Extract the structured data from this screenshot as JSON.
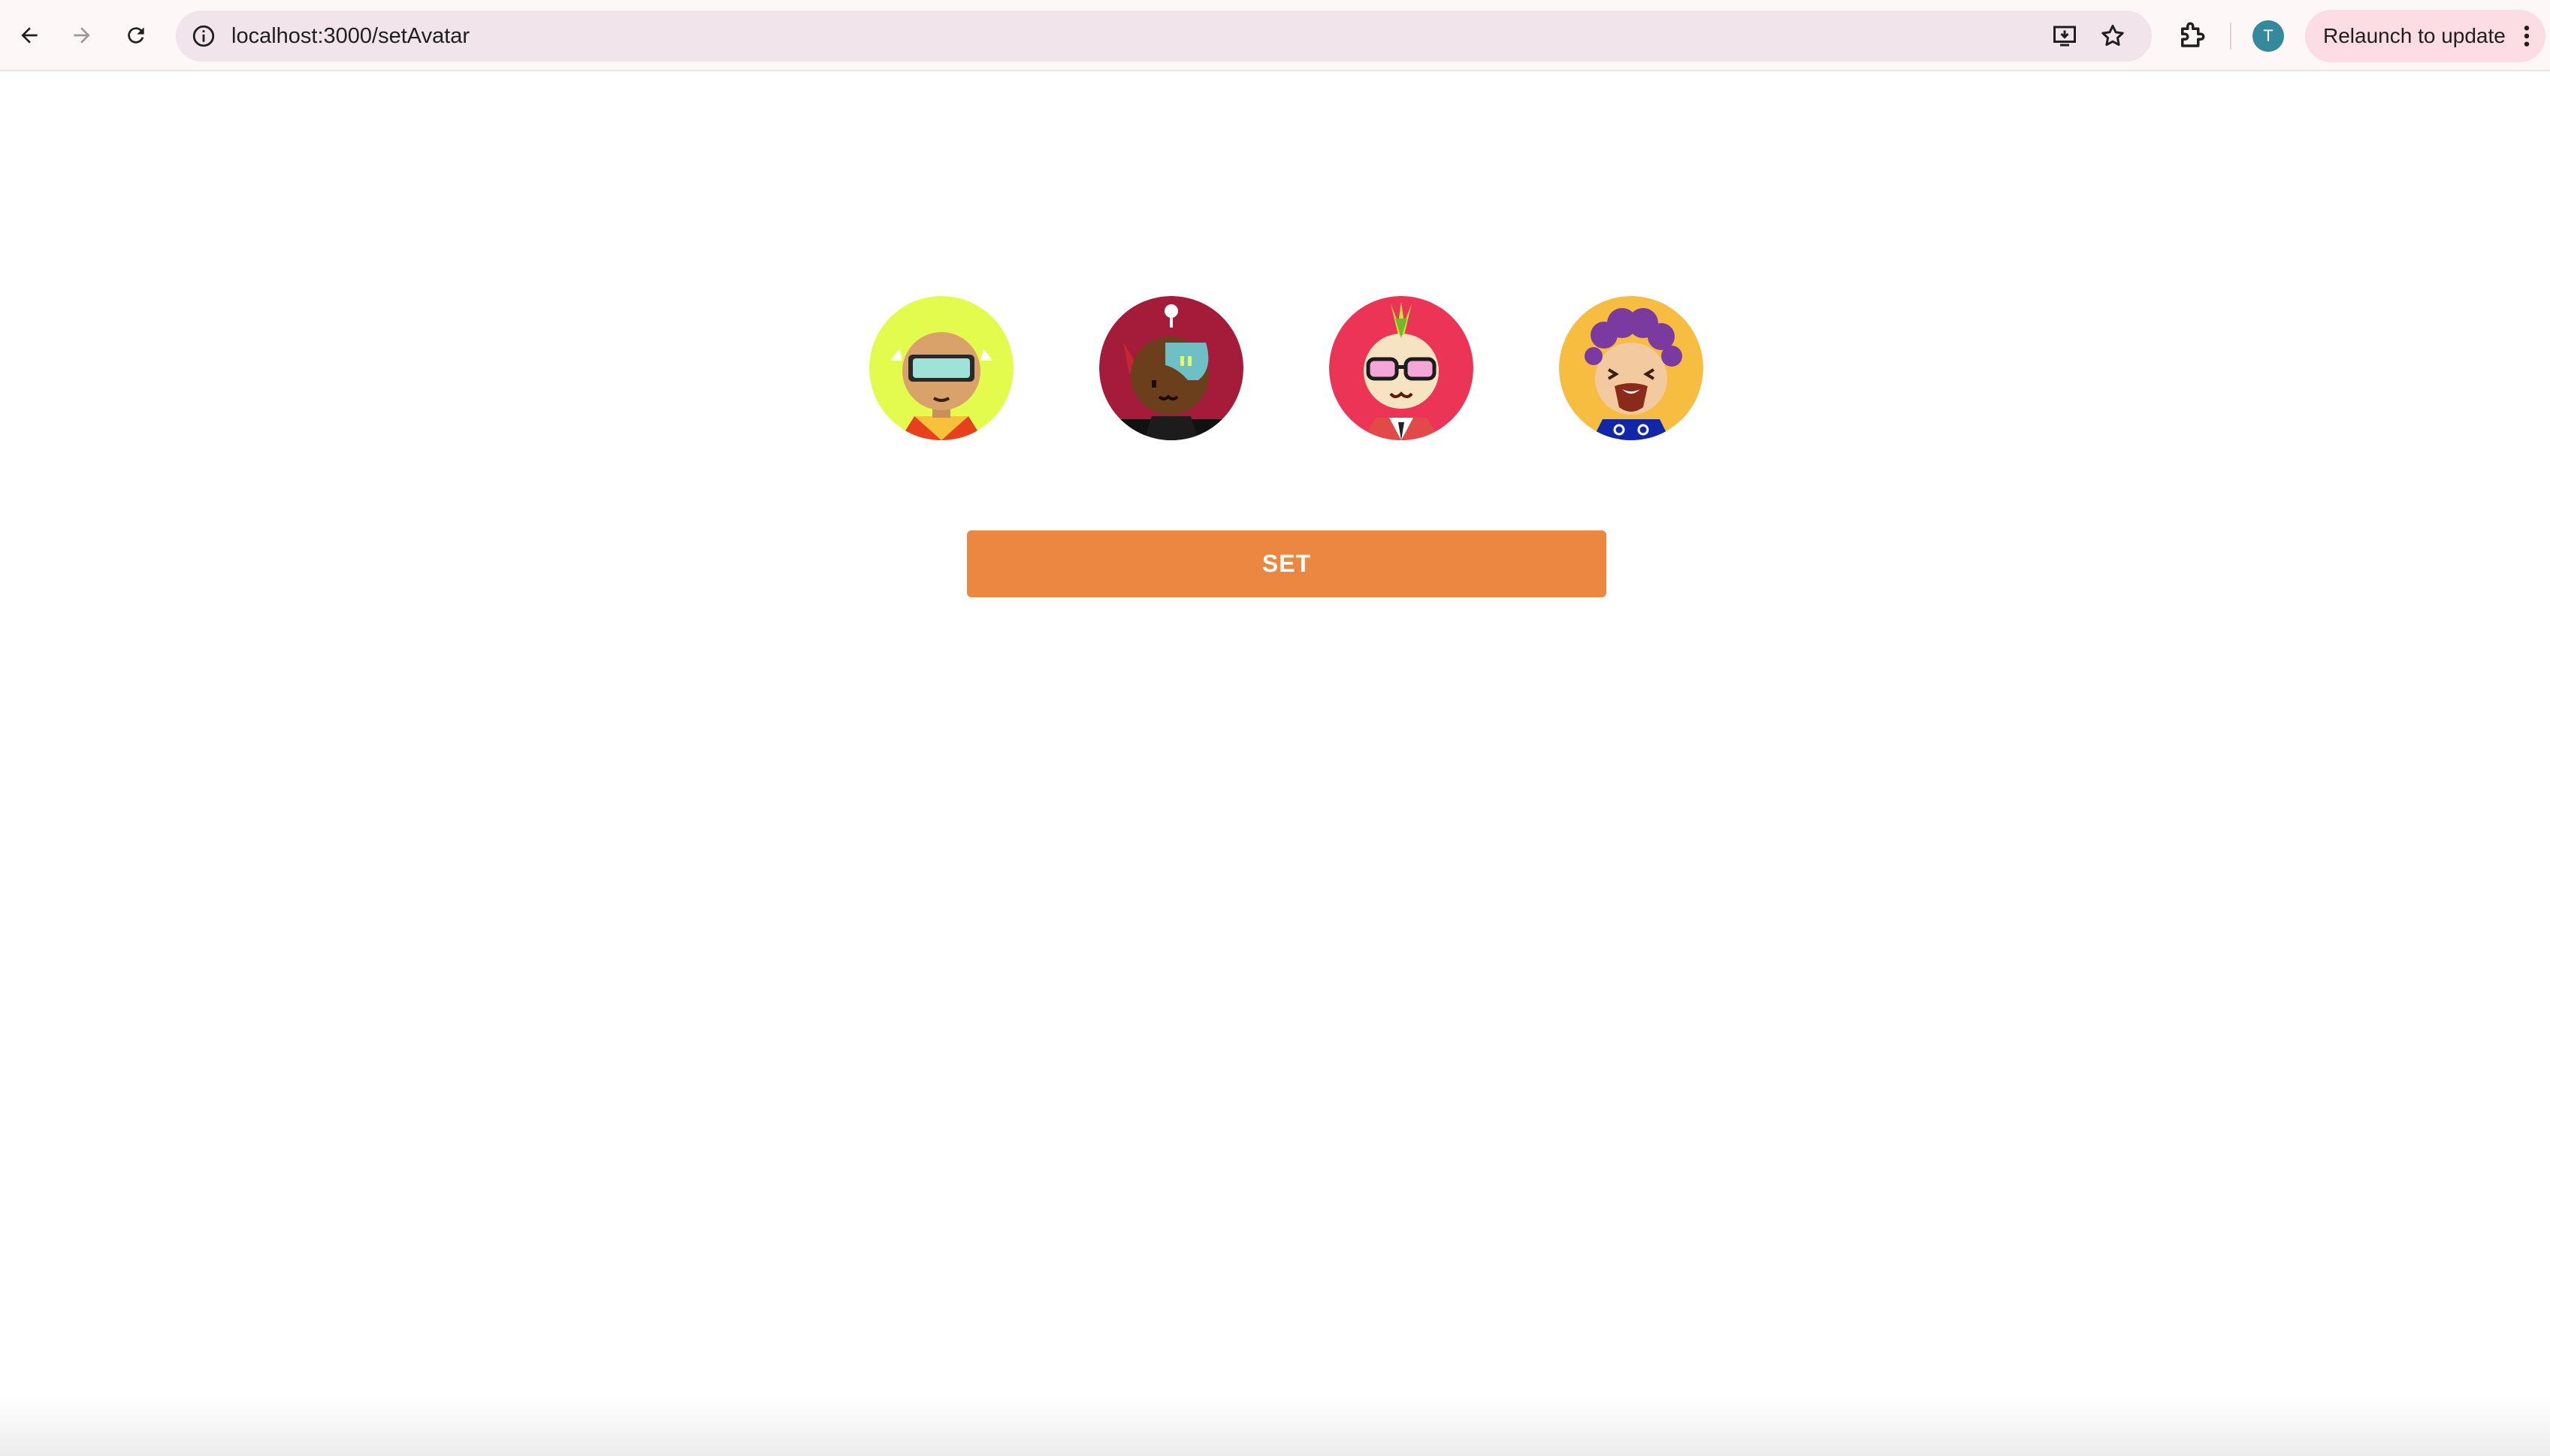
{
  "browser": {
    "url": "localhost:3000/setAvatar",
    "profile_initial": "T",
    "relaunch_label": "Relaunch to update",
    "icons": [
      "back-arrow-icon",
      "forward-arrow-icon",
      "reload-icon",
      "site-info-icon",
      "install-app-icon",
      "bookmark-star-icon",
      "extensions-icon",
      "kebab-menu-icon"
    ]
  },
  "avatars": [
    {
      "name": "avatar-1",
      "background": "#e3fb4c"
    },
    {
      "name": "avatar-2",
      "background": "#a51c3b"
    },
    {
      "name": "avatar-3",
      "background": "#ec3456"
    },
    {
      "name": "avatar-4",
      "background": "#f7bd41"
    }
  ],
  "set_button": {
    "label": "SET",
    "color": "#ec8741"
  }
}
